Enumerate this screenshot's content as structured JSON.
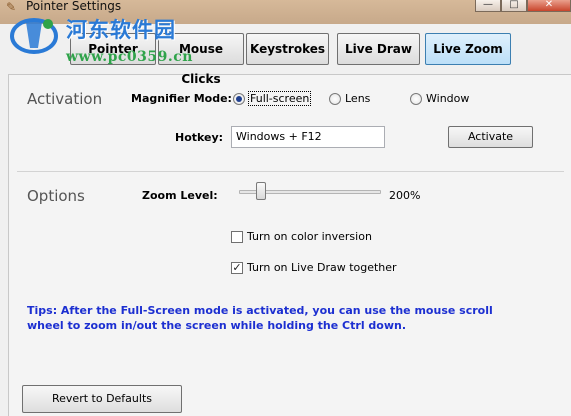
{
  "window": {
    "title": "Pointer Settings",
    "app_icon": "pointer-app-icon",
    "controls": {
      "minimize": "—",
      "maximize": "□",
      "close": "✕"
    }
  },
  "watermark": {
    "logo_icon": "watermark-logo-icon",
    "text": "河东软件园",
    "url": "www.pc0359.cn"
  },
  "tabs": [
    {
      "label": "Pointer",
      "active": false
    },
    {
      "label": "Mouse Clicks",
      "active": false
    },
    {
      "label": "Keystrokes",
      "active": false
    },
    {
      "label": "Live Draw",
      "active": false
    },
    {
      "label": "Live Zoom",
      "active": true
    }
  ],
  "activation": {
    "title": "Activation",
    "magnifier_mode_label": "Magnifier Mode:",
    "modes": [
      {
        "label": "Full-screen",
        "selected": true
      },
      {
        "label": "Lens",
        "selected": false
      },
      {
        "label": "Window",
        "selected": false
      }
    ],
    "hotkey_label": "Hotkey:",
    "hotkey_value": "Windows + F12",
    "activate_button": "Activate"
  },
  "options": {
    "title": "Options",
    "zoom_level_label": "Zoom Level:",
    "zoom_value": "200%",
    "zoom_slider_fraction": 0.13,
    "color_inversion": {
      "label": "Turn on color inversion",
      "checked": false
    },
    "live_draw_together": {
      "label": "Turn on Live Draw together",
      "checked": true
    },
    "tips": "Tips: After the Full-Screen mode is activated, you can use the mouse scroll wheel to zoom in/out the screen while holding the Ctrl down."
  },
  "footer": {
    "revert_button": "Revert to Defaults"
  },
  "colors": {
    "tips_text": "#1c2fd1",
    "active_tab_fill": "#bcdff8",
    "watermark_blue": "#2a7ad6",
    "watermark_green": "#2fa34a"
  }
}
